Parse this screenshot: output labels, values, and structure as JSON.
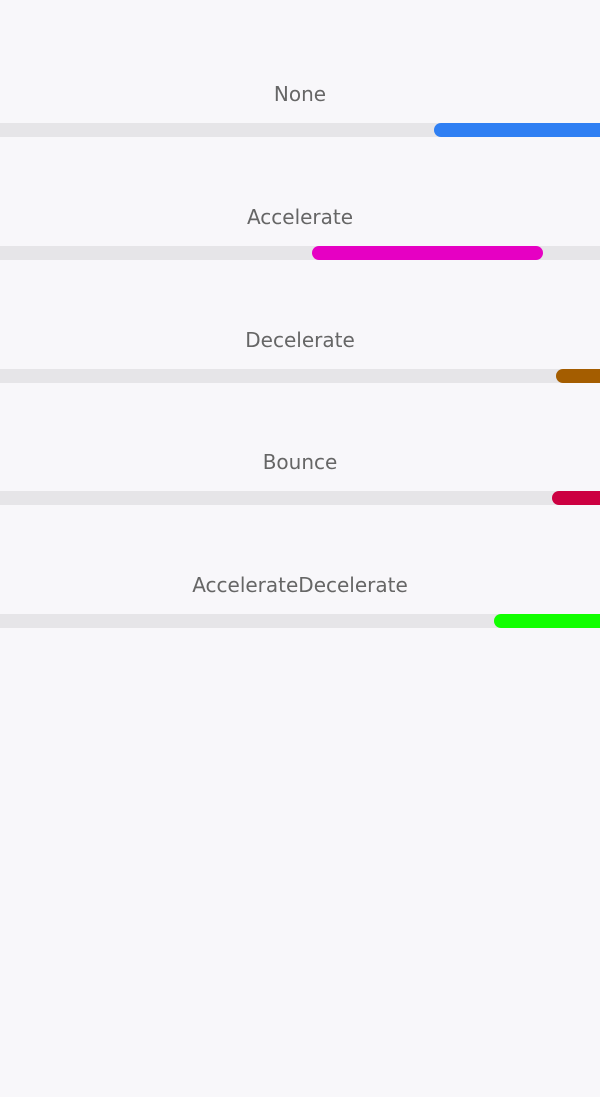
{
  "indicators": [
    {
      "label": "None",
      "color": "#2f7ff3",
      "start": 0.723,
      "end": 1.0
    },
    {
      "label": "Accelerate",
      "color": "#e600c3",
      "start": 0.52,
      "end": 0.905
    },
    {
      "label": "Decelerate",
      "color": "#a45d00",
      "start": 0.927,
      "end": 1.0
    },
    {
      "label": "Bounce",
      "color": "#cc0041",
      "start": 0.92,
      "end": 1.0
    },
    {
      "label": "AccelerateDecelerate",
      "color": "#11ff00",
      "start": 0.823,
      "end": 1.0
    }
  ]
}
